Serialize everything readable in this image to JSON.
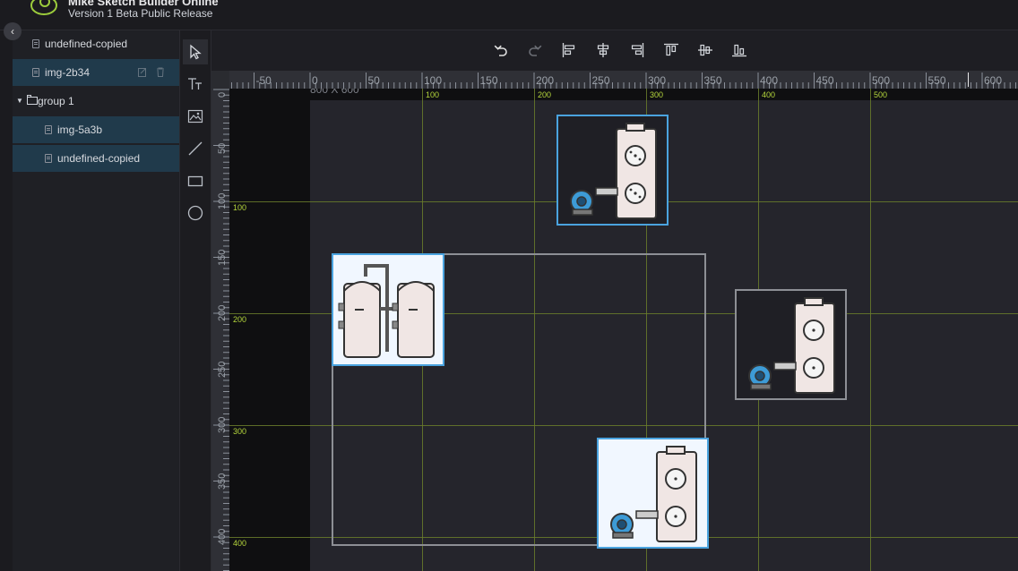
{
  "header": {
    "title": "Mike Sketch Builder Online",
    "version": "Version 1 Beta Public Release"
  },
  "sidebar": {
    "collapse_glyph": "‹",
    "layers": [
      {
        "label": "undefined-copied",
        "icon": "file-icon",
        "selected": false
      },
      {
        "label": "img-2b34",
        "icon": "file-icon",
        "selected": true
      },
      {
        "label": "group 1",
        "icon": "folder-icon",
        "expanded": true
      },
      {
        "label": "img-5a3b",
        "icon": "file-icon",
        "selected": true
      },
      {
        "label": "undefined-copied",
        "icon": "file-icon",
        "selected": true
      }
    ]
  },
  "tools": [
    "select-arrow-icon",
    "text-icon",
    "image-icon",
    "line-icon",
    "rectangle-icon",
    "circle-icon"
  ],
  "toolbar": [
    "undo-icon",
    "redo-icon",
    "align-left-icon",
    "align-center-horizontal-icon",
    "align-right-icon",
    "align-top-icon",
    "align-middle-vertical-icon",
    "align-bottom-icon"
  ],
  "canvas": {
    "artboard_label": "800 X 600",
    "ruler_top_ticks": [
      "-50",
      "0",
      "50",
      "100",
      "150",
      "200",
      "250",
      "300",
      "350",
      "400",
      "450",
      "500",
      "550",
      "600"
    ],
    "ruler_left_ticks": [
      "0",
      "50",
      "100",
      "150",
      "200",
      "250",
      "300",
      "350",
      "400"
    ],
    "guides_vertical": [
      "100",
      "200",
      "300",
      "400",
      "500"
    ],
    "guides_horizontal": [
      "100",
      "200",
      "300",
      "400"
    ]
  },
  "colors": {
    "background": "#1e1e23",
    "selection": "#4aa3df",
    "guide": "#b4d53c",
    "layer_selected": "#203a4b"
  }
}
